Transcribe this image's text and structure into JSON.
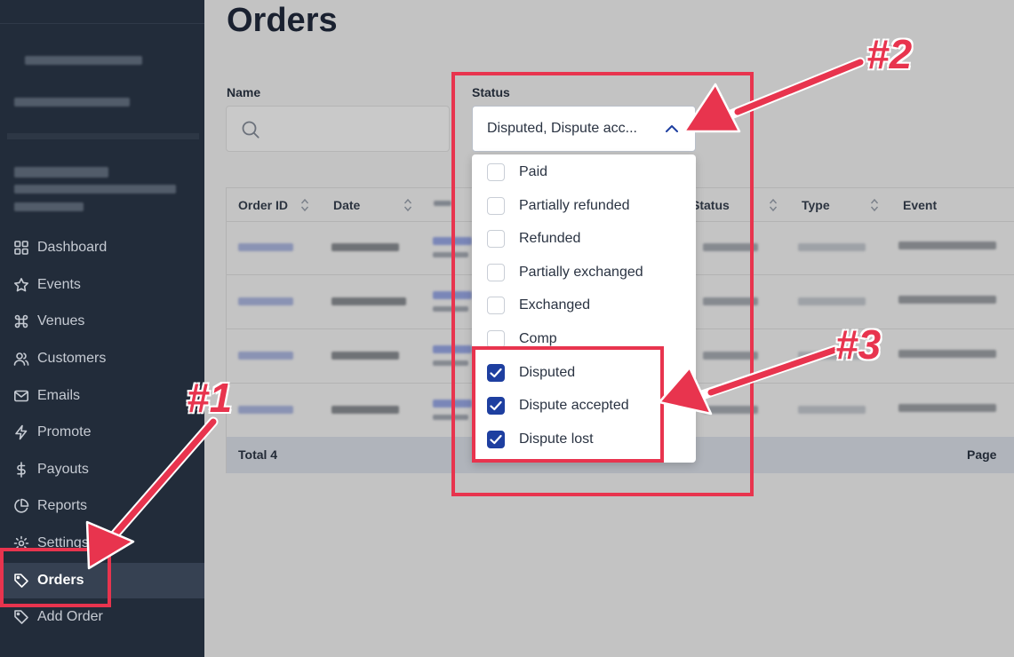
{
  "sidebar": {
    "items": [
      {
        "label": "Dashboard",
        "icon": "grid-icon"
      },
      {
        "label": "Events",
        "icon": "star-icon"
      },
      {
        "label": "Venues",
        "icon": "command-icon"
      },
      {
        "label": "Customers",
        "icon": "users-icon"
      },
      {
        "label": "Emails",
        "icon": "mail-icon"
      },
      {
        "label": "Promote",
        "icon": "zap-icon"
      },
      {
        "label": "Payouts",
        "icon": "dollar-icon"
      },
      {
        "label": "Reports",
        "icon": "pie-chart-icon"
      },
      {
        "label": "Settings",
        "icon": "gear-icon"
      },
      {
        "label": "Orders",
        "icon": "tag-icon",
        "active": true
      },
      {
        "label": "Add Order",
        "icon": "tag-icon"
      }
    ]
  },
  "main": {
    "title": "Orders",
    "filters": {
      "name_label": "Name",
      "status_label": "Status",
      "status_value": "Disputed, Dispute acc..."
    },
    "table": {
      "columns": [
        "Order ID",
        "Date",
        "Status",
        "Type",
        "Event"
      ],
      "footer_total": "Total 4",
      "footer_page": "Page"
    }
  },
  "status_dropdown": {
    "options": [
      {
        "label": "Paid",
        "checked": false
      },
      {
        "label": "Partially refunded",
        "checked": false
      },
      {
        "label": "Refunded",
        "checked": false
      },
      {
        "label": "Partially exchanged",
        "checked": false
      },
      {
        "label": "Exchanged",
        "checked": false
      },
      {
        "label": "Comp",
        "checked": false
      },
      {
        "label": "Disputed",
        "checked": true
      },
      {
        "label": "Dispute accepted",
        "checked": true
      },
      {
        "label": "Dispute lost",
        "checked": true
      }
    ]
  },
  "annotations": {
    "one": "#1",
    "two": "#2",
    "three": "#3",
    "color": "#e8344e"
  }
}
